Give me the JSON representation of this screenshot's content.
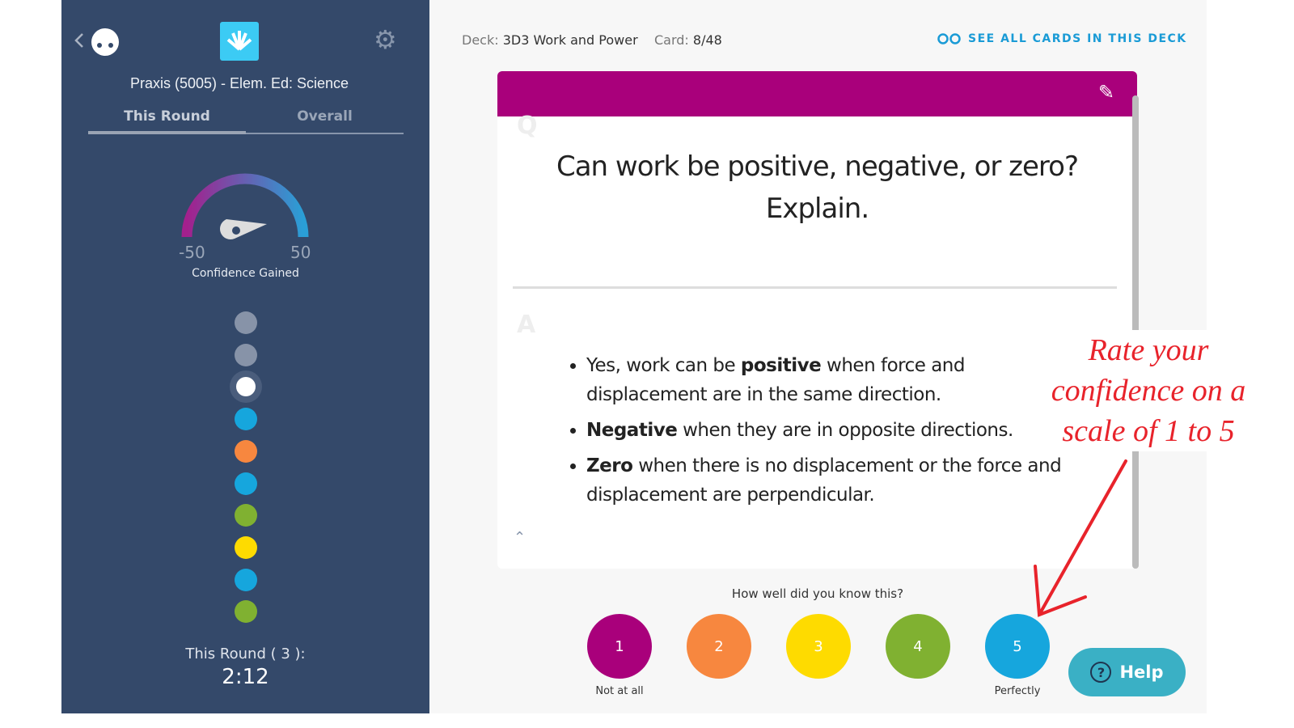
{
  "sidebar": {
    "title": "Praxis (5005) - Elem. Ed: Science",
    "tabs": [
      {
        "label": "This Round",
        "active": true
      },
      {
        "label": "Overall",
        "active": false
      }
    ],
    "gauge": {
      "min": "-50",
      "max": "50",
      "caption": "Confidence Gained"
    },
    "progress_dots": [
      "#8793a8",
      "#8793a8",
      "#ffffff",
      "#16a6dd",
      "#f7873f",
      "#16a6dd",
      "#80b131",
      "#fedb00",
      "#16a6dd",
      "#80b131"
    ],
    "round_label": "This Round ( 3 ):",
    "round_time": "2:12"
  },
  "header": {
    "deck_label": "Deck:",
    "deck_name": "3D3 Work and Power",
    "card_label": "Card:",
    "card_value": "8/48",
    "see_all": "SEE ALL CARDS IN THIS DECK"
  },
  "card": {
    "header_color": "#a9007b",
    "q_letter": "Q",
    "a_letter": "A",
    "question": "Can work be positive, negative, or zero? Explain.",
    "answer": [
      {
        "pre": "Yes, work can be ",
        "bold": "positive",
        "post": " when force and displacement are in the same direction."
      },
      {
        "pre": "",
        "bold": "Negative",
        "post": " when they are in opposite directions."
      },
      {
        "pre": "",
        "bold": "Zero",
        "post": " when there is no displacement or the force and displacement are perpendicular."
      }
    ]
  },
  "rating": {
    "prompt": "How well did you know this?",
    "buttons": [
      {
        "label": "1",
        "color": "#a9007b"
      },
      {
        "label": "2",
        "color": "#f7873f"
      },
      {
        "label": "3",
        "color": "#fedb00"
      },
      {
        "label": "4",
        "color": "#80b131"
      },
      {
        "label": "5",
        "color": "#16a6dd"
      }
    ],
    "low_label": "Not at all",
    "high_label": "Perfectly"
  },
  "help": {
    "label": "Help"
  },
  "annotation": {
    "text": "Rate your confidence on a scale of 1 to 5",
    "color": "#e8232b"
  }
}
